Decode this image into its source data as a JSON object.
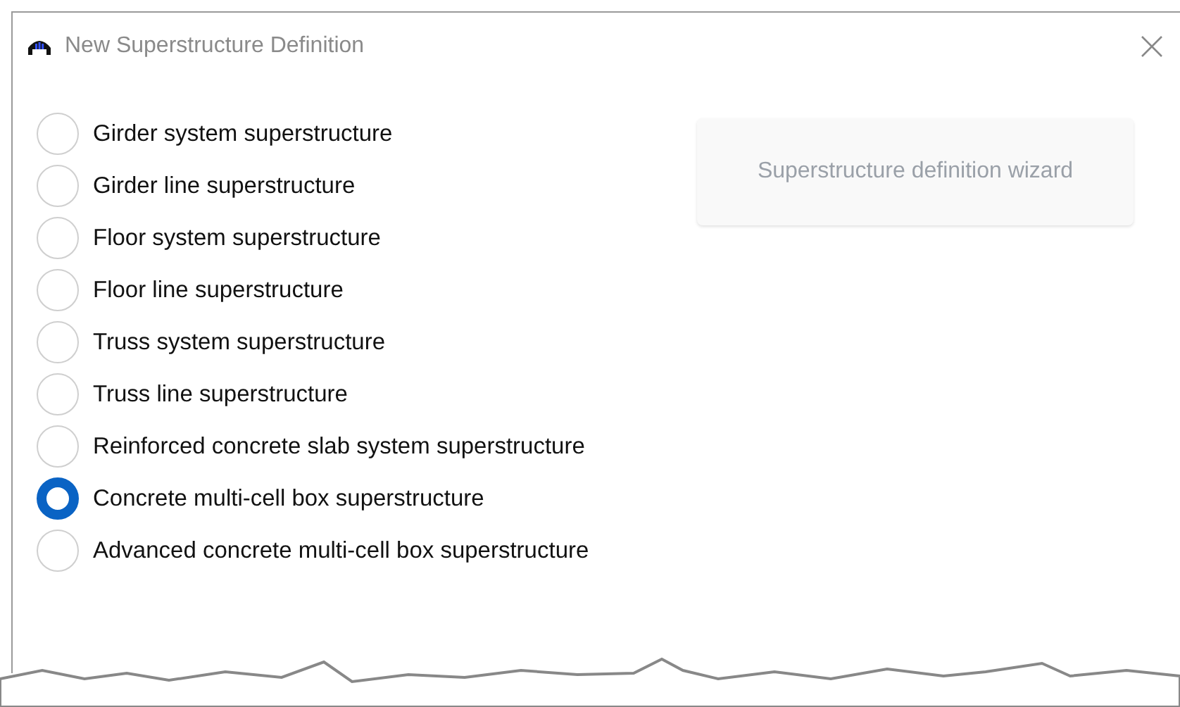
{
  "window": {
    "title": "New Superstructure Definition"
  },
  "options": [
    {
      "label": "Girder system superstructure",
      "selected": false
    },
    {
      "label": "Girder line superstructure",
      "selected": false
    },
    {
      "label": "Floor system superstructure",
      "selected": false
    },
    {
      "label": "Floor line superstructure",
      "selected": false
    },
    {
      "label": "Truss system superstructure",
      "selected": false
    },
    {
      "label": "Truss line superstructure",
      "selected": false
    },
    {
      "label": "Reinforced concrete slab system superstructure",
      "selected": false
    },
    {
      "label": "Concrete multi-cell box superstructure",
      "selected": true
    },
    {
      "label": "Advanced concrete multi-cell box superstructure",
      "selected": false
    }
  ],
  "wizard_button": {
    "label": "Superstructure definition wizard",
    "disabled": true
  }
}
